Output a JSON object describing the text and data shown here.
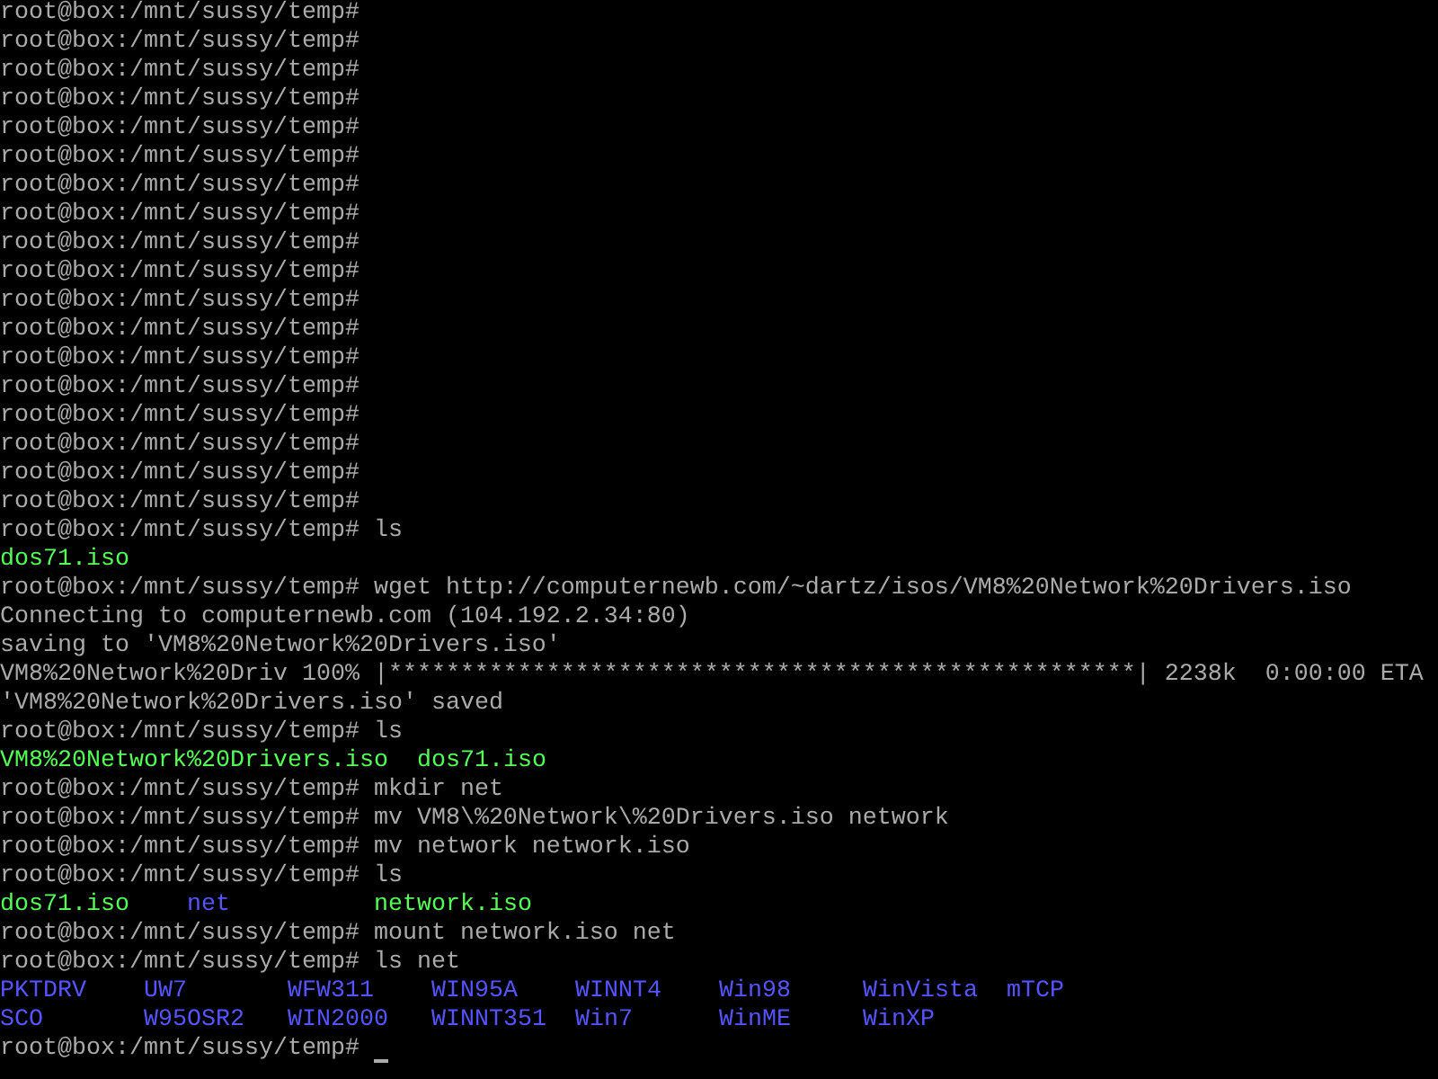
{
  "terminal": {
    "lines": [
      {
        "kind": "text",
        "text": "root@box:/mnt/sussy/temp#"
      },
      {
        "kind": "text",
        "text": "root@box:/mnt/sussy/temp#"
      },
      {
        "kind": "text",
        "text": "root@box:/mnt/sussy/temp#"
      },
      {
        "kind": "text",
        "text": "root@box:/mnt/sussy/temp#"
      },
      {
        "kind": "text",
        "text": "root@box:/mnt/sussy/temp#"
      },
      {
        "kind": "text",
        "text": "root@box:/mnt/sussy/temp#"
      },
      {
        "kind": "text",
        "text": "root@box:/mnt/sussy/temp#"
      },
      {
        "kind": "text",
        "text": "root@box:/mnt/sussy/temp#"
      },
      {
        "kind": "text",
        "text": "root@box:/mnt/sussy/temp#"
      },
      {
        "kind": "text",
        "text": "root@box:/mnt/sussy/temp#"
      },
      {
        "kind": "text",
        "text": "root@box:/mnt/sussy/temp#"
      },
      {
        "kind": "text",
        "text": "root@box:/mnt/sussy/temp#"
      },
      {
        "kind": "text",
        "text": "root@box:/mnt/sussy/temp#"
      },
      {
        "kind": "text",
        "text": "root@box:/mnt/sussy/temp#"
      },
      {
        "kind": "text",
        "text": "root@box:/mnt/sussy/temp#"
      },
      {
        "kind": "text",
        "text": "root@box:/mnt/sussy/temp#"
      },
      {
        "kind": "text",
        "text": "root@box:/mnt/sussy/temp#"
      },
      {
        "kind": "text",
        "text": "root@box:/mnt/sussy/temp#"
      },
      {
        "kind": "text",
        "text": "root@box:/mnt/sussy/temp# ls"
      },
      {
        "kind": "listing",
        "entries": [
          {
            "name": "dos71.iso",
            "color": "#55ff55"
          }
        ]
      },
      {
        "kind": "text",
        "text": "root@box:/mnt/sussy/temp# wget http://computernewb.com/~dartz/isos/VM8%20Network%20Drivers.iso"
      },
      {
        "kind": "text",
        "text": "Connecting to computernewb.com (104.192.2.34:80)"
      },
      {
        "kind": "text",
        "text": "saving to 'VM8%20Network%20Drivers.iso'"
      },
      {
        "kind": "text",
        "text": "VM8%20Network%20Driv 100% |****************************************************| 2238k  0:00:00 ETA"
      },
      {
        "kind": "text",
        "text": "'VM8%20Network%20Drivers.iso' saved"
      },
      {
        "kind": "text",
        "text": "root@box:/mnt/sussy/temp# ls"
      },
      {
        "kind": "listing",
        "entries": [
          {
            "name": "VM8%20Network%20Drivers.iso",
            "color": "#55ff55"
          },
          {
            "name": "dos71.iso",
            "color": "#55ff55"
          }
        ]
      },
      {
        "kind": "text",
        "text": "root@box:/mnt/sussy/temp# mkdir net"
      },
      {
        "kind": "text",
        "text": "root@box:/mnt/sussy/temp# mv VM8\\%20Network\\%20Drivers.iso network"
      },
      {
        "kind": "text",
        "text": "root@box:/mnt/sussy/temp# mv network network.iso"
      },
      {
        "kind": "text",
        "text": "root@box:/mnt/sussy/temp# ls"
      },
      {
        "kind": "listing",
        "entries": [
          {
            "name": "dos71.iso",
            "color": "#55ff55"
          },
          {
            "name": "net",
            "color": "#5555ff"
          },
          {
            "name": "network.iso",
            "color": "#55ff55"
          }
        ]
      },
      {
        "kind": "text",
        "text": "root@box:/mnt/sussy/temp# mount network.iso net"
      },
      {
        "kind": "text",
        "text": "root@box:/mnt/sussy/temp# ls net"
      },
      {
        "kind": "listing",
        "entries": [
          {
            "name": "PKTDRV",
            "color": "#5555ff"
          },
          {
            "name": "UW7",
            "color": "#5555ff"
          },
          {
            "name": "WFW311",
            "color": "#5555ff"
          },
          {
            "name": "WIN95A",
            "color": "#5555ff"
          },
          {
            "name": "WINNT4",
            "color": "#5555ff"
          },
          {
            "name": "Win98",
            "color": "#5555ff"
          },
          {
            "name": "WinVista",
            "color": "#5555ff"
          },
          {
            "name": "mTCP",
            "color": "#5555ff"
          }
        ]
      },
      {
        "kind": "listing",
        "entries": [
          {
            "name": "SCO",
            "color": "#5555ff"
          },
          {
            "name": "W95OSR2",
            "color": "#5555ff"
          },
          {
            "name": "WIN2000",
            "color": "#5555ff"
          },
          {
            "name": "WINNT351",
            "color": "#5555ff"
          },
          {
            "name": "Win7",
            "color": "#5555ff"
          },
          {
            "name": "WinME",
            "color": "#5555ff"
          },
          {
            "name": "WinXP",
            "color": "#5555ff"
          }
        ]
      },
      {
        "kind": "text",
        "text": "root@box:/mnt/sussy/temp#",
        "cursor": true
      }
    ]
  }
}
